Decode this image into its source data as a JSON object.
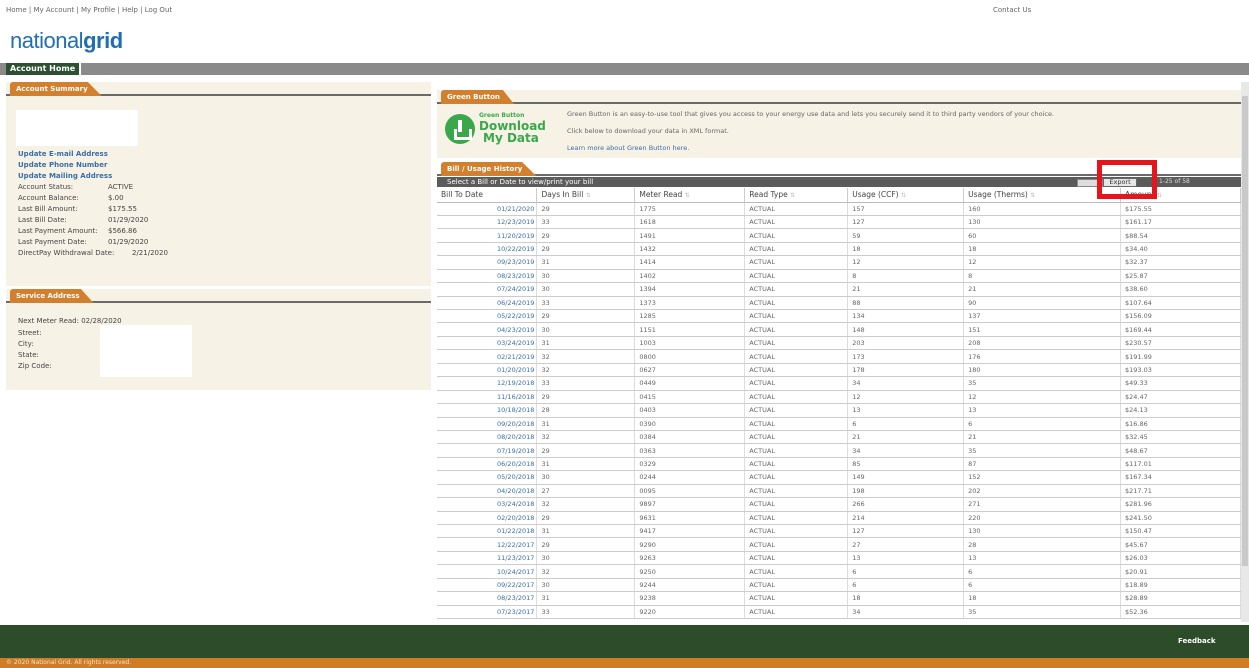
{
  "header": {
    "top_links": "Home | My Account | My Profile | Help | Log Out",
    "contact": "Contact Us",
    "logo_light": "national",
    "logo_bold": "grid"
  },
  "nav": {
    "home_tab": "Account Home"
  },
  "account_summary": {
    "tab": "Account Summary",
    "links": [
      "Update E-mail Address",
      "Update Phone Number",
      "Update Mailing Address"
    ],
    "rows": [
      {
        "label": "Account Status:",
        "value": "ACTIVE"
      },
      {
        "label": "Account Balance:",
        "value": "$.00"
      },
      {
        "label": "Last Bill Amount:",
        "value": "$175.55"
      },
      {
        "label": "Last Bill Date:",
        "value": "01/29/2020"
      },
      {
        "label": "Last Payment Amount:",
        "value": "$566.86"
      },
      {
        "label": "Last Payment Date:",
        "value": "01/29/2020"
      },
      {
        "label": "DirectPay Withdrawal Date:",
        "value": "2/21/2020"
      }
    ]
  },
  "service_address": {
    "tab": "Service Address",
    "next_meter_read": "Next Meter Read: 02/28/2020",
    "rows": [
      "Street:",
      "City:",
      "State:",
      "Zip Code:"
    ]
  },
  "green_button": {
    "tab": "Green Button",
    "badge_small": "Green Button",
    "badge_line1": "Download",
    "badge_line2": "My Data",
    "text1": "Green Button is an easy-to-use tool that gives you access to your energy use data and lets you securely send it to third party vendors of your choice.",
    "text2": "Click below to download your data in XML format.",
    "text3": "Learn more about Green Button here."
  },
  "bill_history": {
    "tab": "Bill / Usage History",
    "subbar": "Select a Bill or Date to view/print your bill",
    "export_label": "Export",
    "pager": "1-25 of 58",
    "columns": [
      "Bill To Date",
      "Days In Bill",
      "Meter Read",
      "Read Type",
      "Usage (CCF)",
      "Usage (Therms)",
      "Amount"
    ],
    "rows": [
      [
        "01/21/2020",
        "29",
        "1775",
        "ACTUAL",
        "157",
        "160",
        "$175.55"
      ],
      [
        "12/23/2019",
        "33",
        "1618",
        "ACTUAL",
        "127",
        "130",
        "$161.17"
      ],
      [
        "11/20/2019",
        "29",
        "1491",
        "ACTUAL",
        "59",
        "60",
        "$88.54"
      ],
      [
        "10/22/2019",
        "29",
        "1432",
        "ACTUAL",
        "18",
        "18",
        "$34.40"
      ],
      [
        "09/23/2019",
        "31",
        "1414",
        "ACTUAL",
        "12",
        "12",
        "$32.37"
      ],
      [
        "08/23/2019",
        "30",
        "1402",
        "ACTUAL",
        "8",
        "8",
        "$25.87"
      ],
      [
        "07/24/2019",
        "30",
        "1394",
        "ACTUAL",
        "21",
        "21",
        "$38.60"
      ],
      [
        "06/24/2019",
        "33",
        "1373",
        "ACTUAL",
        "88",
        "90",
        "$107.64"
      ],
      [
        "05/22/2019",
        "29",
        "1285",
        "ACTUAL",
        "134",
        "137",
        "$156.09"
      ],
      [
        "04/23/2019",
        "30",
        "1151",
        "ACTUAL",
        "148",
        "151",
        "$169.44"
      ],
      [
        "03/24/2019",
        "31",
        "1003",
        "ACTUAL",
        "203",
        "208",
        "$230.57"
      ],
      [
        "02/21/2019",
        "32",
        "0800",
        "ACTUAL",
        "173",
        "176",
        "$191.99"
      ],
      [
        "01/20/2019",
        "32",
        "0627",
        "ACTUAL",
        "178",
        "180",
        "$193.03"
      ],
      [
        "12/19/2018",
        "33",
        "0449",
        "ACTUAL",
        "34",
        "35",
        "$49.33"
      ],
      [
        "11/16/2018",
        "29",
        "0415",
        "ACTUAL",
        "12",
        "12",
        "$24.47"
      ],
      [
        "10/18/2018",
        "28",
        "0403",
        "ACTUAL",
        "13",
        "13",
        "$24.13"
      ],
      [
        "09/20/2018",
        "31",
        "0390",
        "ACTUAL",
        "6",
        "6",
        "$16.86"
      ],
      [
        "08/20/2018",
        "32",
        "0384",
        "ACTUAL",
        "21",
        "21",
        "$32.45"
      ],
      [
        "07/19/2018",
        "29",
        "0363",
        "ACTUAL",
        "34",
        "35",
        "$48.67"
      ],
      [
        "06/20/2018",
        "31",
        "0329",
        "ACTUAL",
        "85",
        "87",
        "$117.01"
      ],
      [
        "05/20/2018",
        "30",
        "0244",
        "ACTUAL",
        "149",
        "152",
        "$167.34"
      ],
      [
        "04/20/2018",
        "27",
        "0095",
        "ACTUAL",
        "198",
        "202",
        "$217.71"
      ],
      [
        "03/24/2018",
        "32",
        "9897",
        "ACTUAL",
        "266",
        "271",
        "$281.96"
      ],
      [
        "02/20/2018",
        "29",
        "9631",
        "ACTUAL",
        "214",
        "220",
        "$241.50"
      ],
      [
        "01/22/2018",
        "31",
        "9417",
        "ACTUAL",
        "127",
        "130",
        "$150.47"
      ],
      [
        "12/22/2017",
        "29",
        "9290",
        "ACTUAL",
        "27",
        "28",
        "$45.67"
      ],
      [
        "11/23/2017",
        "30",
        "9263",
        "ACTUAL",
        "13",
        "13",
        "$26.03"
      ],
      [
        "10/24/2017",
        "32",
        "9250",
        "ACTUAL",
        "6",
        "6",
        "$20.91"
      ],
      [
        "09/22/2017",
        "30",
        "9244",
        "ACTUAL",
        "6",
        "6",
        "$18.89"
      ],
      [
        "08/23/2017",
        "31",
        "9238",
        "ACTUAL",
        "18",
        "18",
        "$28.89"
      ],
      [
        "07/23/2017",
        "33",
        "9220",
        "ACTUAL",
        "34",
        "35",
        "$52.36"
      ]
    ]
  },
  "footer": {
    "feedback": "Feedback",
    "copyright": "© 2020 National Grid. All rights reserved."
  }
}
